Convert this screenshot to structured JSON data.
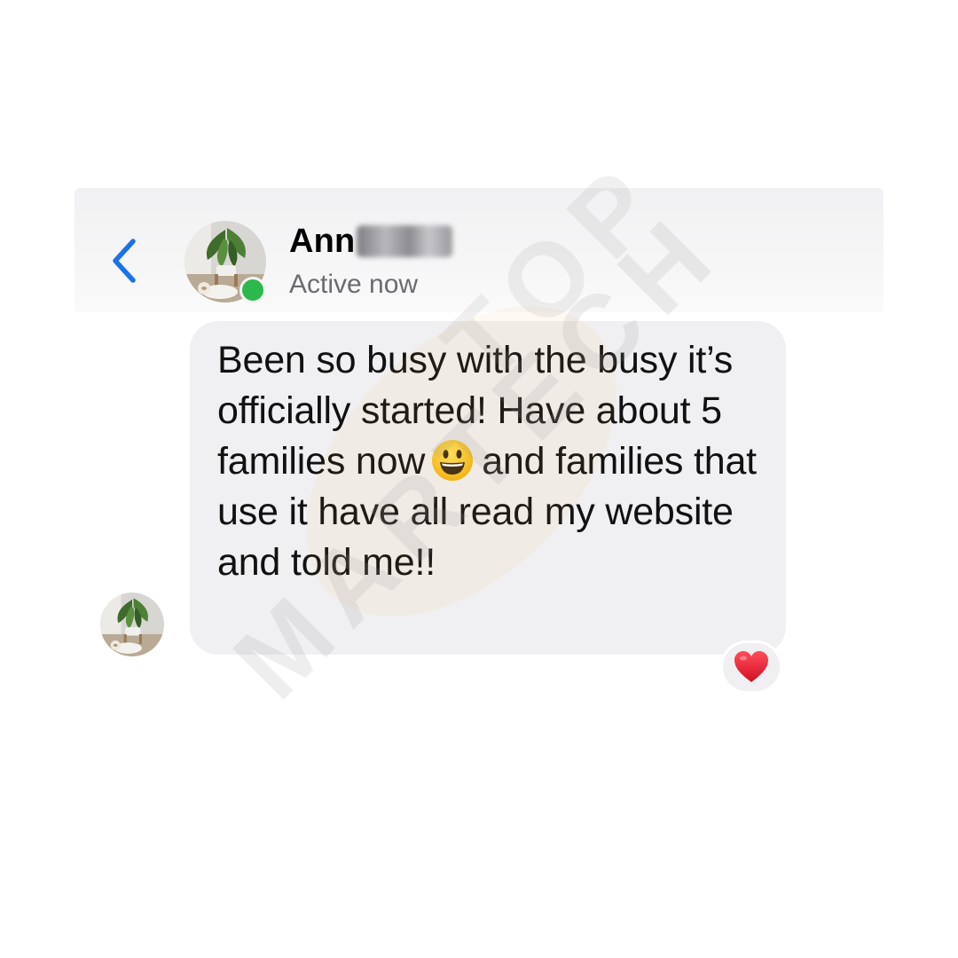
{
  "header": {
    "contact_name": "Ann",
    "status": "Active now",
    "online": true
  },
  "message": {
    "lines_before_emoji": "Been so busy with the busy it’s officially started! Have about 5 families now",
    "emoji": "smiling-face-with-open-mouth",
    "lines_after_emoji": "and families that use it have all read my website and told me!!",
    "reaction": "red-heart"
  },
  "watermark": {
    "text_1": "MARTECH",
    "text_2": "TOP"
  },
  "colors": {
    "accent_blue": "#1a73e8",
    "online_green": "#2db84d",
    "bubble_bg": "#f0f0f2",
    "heart_red": "#e6192b"
  }
}
